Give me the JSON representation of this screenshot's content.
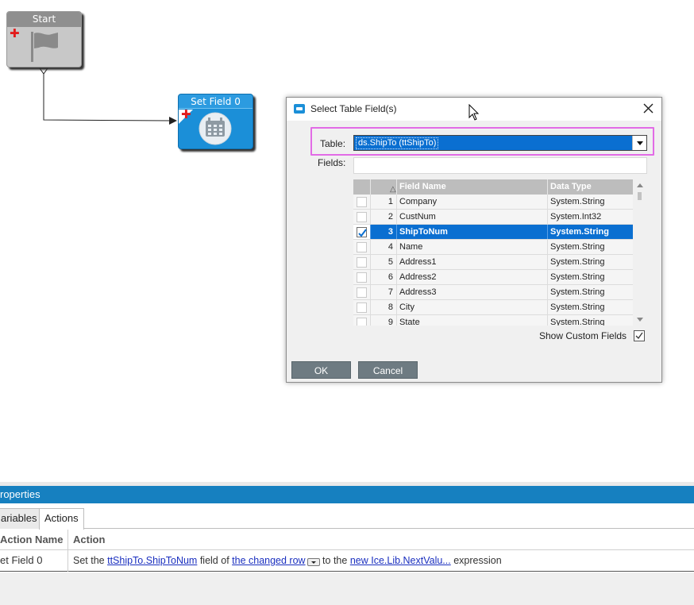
{
  "workflow": {
    "start_node": {
      "title": "Start"
    },
    "set_field_node": {
      "title": "Set Field 0"
    }
  },
  "dialog": {
    "title": "Select Table Field(s)",
    "table_label": "Table:",
    "table_value": "ds.ShipTo (ttShipTo)",
    "fields_label": "Fields:",
    "fields_value": "",
    "columns": {
      "sort_icon": "△",
      "field_name": "Field Name",
      "data_type": "Data Type"
    },
    "rows": [
      {
        "num": "1",
        "name": "Company",
        "type": "System.String",
        "checked": false
      },
      {
        "num": "2",
        "name": "CustNum",
        "type": "System.Int32",
        "checked": false
      },
      {
        "num": "3",
        "name": "ShipToNum",
        "type": "System.String",
        "checked": true
      },
      {
        "num": "4",
        "name": "Name",
        "type": "System.String",
        "checked": false
      },
      {
        "num": "5",
        "name": "Address1",
        "type": "System.String",
        "checked": false
      },
      {
        "num": "6",
        "name": "Address2",
        "type": "System.String",
        "checked": false
      },
      {
        "num": "7",
        "name": "Address3",
        "type": "System.String",
        "checked": false
      },
      {
        "num": "8",
        "name": "City",
        "type": "System.String",
        "checked": false
      },
      {
        "num": "9",
        "name": "State",
        "type": "System.String",
        "checked": false
      }
    ],
    "show_custom_fields_label": "Show Custom Fields",
    "show_custom_fields_checked": true,
    "ok_label": "OK",
    "cancel_label": "Cancel"
  },
  "properties": {
    "title": "roperties",
    "tabs": [
      "ariables",
      "Actions"
    ],
    "active_tab": "Actions",
    "columns": {
      "action_name": "Action Name",
      "action": "Action"
    },
    "row": {
      "action_name": "et Field 0",
      "text_1": "Set the ",
      "link_field": "ttShipTo.ShipToNum",
      "text_2": " field of ",
      "link_row": "the changed row",
      "text_3": " to the ",
      "link_expr": "new Ice.Lib.NextValu...",
      "text_4": " expression"
    }
  },
  "colors": {
    "accent_blue": "#1680c0",
    "selection_blue": "#0a6fd1",
    "highlight_pink": "#e26be6",
    "node_blue": "#1b8fd8",
    "button_gray": "#6e7b82"
  }
}
